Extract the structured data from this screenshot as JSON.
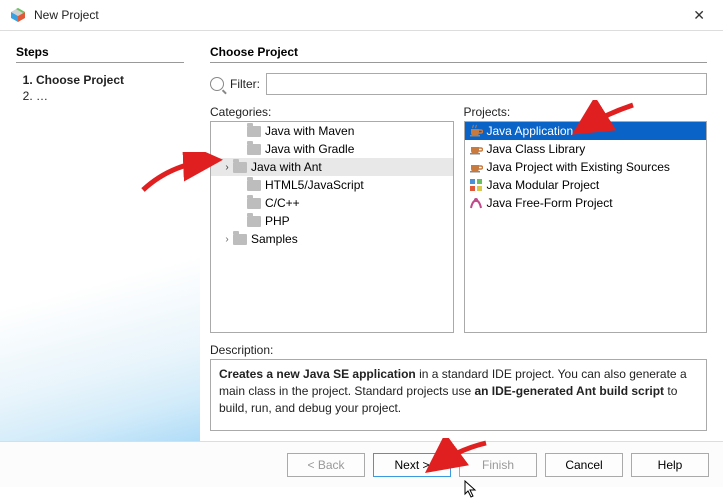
{
  "titlebar": {
    "title": "New Project"
  },
  "steps": {
    "heading": "Steps",
    "items": [
      {
        "label": "Choose Project",
        "current": true
      },
      {
        "label": "…",
        "current": false
      }
    ]
  },
  "choose": {
    "heading": "Choose Project",
    "filter_label": "Filter:",
    "filter_value": ""
  },
  "categories": {
    "label": "Categories:",
    "items": [
      {
        "label": "Java with Maven",
        "expandable": false,
        "indent": 1,
        "selected": false
      },
      {
        "label": "Java with Gradle",
        "expandable": false,
        "indent": 1,
        "selected": false
      },
      {
        "label": "Java with Ant",
        "expandable": true,
        "indent": 1,
        "selected": true
      },
      {
        "label": "HTML5/JavaScript",
        "expandable": false,
        "indent": 1,
        "selected": false
      },
      {
        "label": "C/C++",
        "expandable": false,
        "indent": 1,
        "selected": false
      },
      {
        "label": "PHP",
        "expandable": false,
        "indent": 1,
        "selected": false
      },
      {
        "label": "Samples",
        "expandable": true,
        "indent": 1,
        "selected": false
      }
    ]
  },
  "projects": {
    "label": "Projects:",
    "items": [
      {
        "label": "Java Application",
        "icon": "coffee",
        "selected": true
      },
      {
        "label": "Java Class Library",
        "icon": "coffee",
        "selected": false
      },
      {
        "label": "Java Project with Existing Sources",
        "icon": "coffee",
        "selected": false
      },
      {
        "label": "Java Modular Project",
        "icon": "module",
        "selected": false
      },
      {
        "label": "Java Free-Form Project",
        "icon": "freeform",
        "selected": false
      }
    ]
  },
  "description": {
    "label": "Description:",
    "text_parts": {
      "a": "Creates a new Java SE application",
      "b": " in a standard IDE project. You can also generate a main class in the project. Standard projects use ",
      "c": "an IDE-generated Ant build script",
      "d": " to build, run, and debug your project."
    }
  },
  "buttons": {
    "back": "< Back",
    "next": "Next >",
    "finish": "Finish",
    "cancel": "Cancel",
    "help": "Help"
  }
}
